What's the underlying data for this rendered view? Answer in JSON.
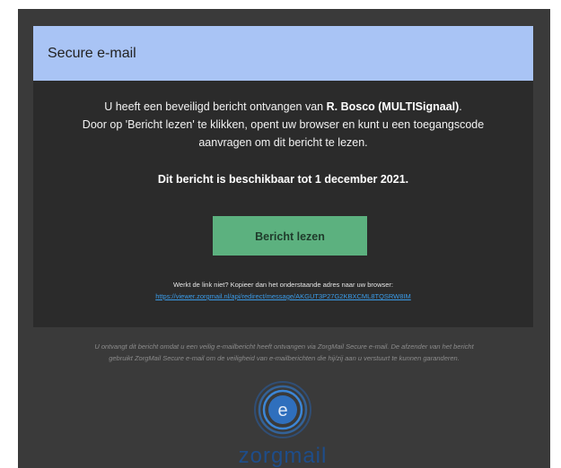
{
  "header": {
    "title": "Secure e-mail"
  },
  "message": {
    "line1_prefix": "U heeft een beveiligd bericht ontvangen van ",
    "sender": "R. Bosco (MULTISignaal)",
    "line1_suffix": ".",
    "line2": "Door op 'Bericht lezen' te klikken, opent uw browser en kunt u een toegangscode",
    "line3": "aanvragen om dit bericht te lezen.",
    "availability": "Dit bericht is beschikbaar tot 1 december 2021."
  },
  "actions": {
    "read_button_label": "Bericht lezen"
  },
  "fallback": {
    "hint": "Werkt de link niet? Kopieer dan het onderstaande adres naar uw browser:",
    "link": "https://viewer.zorgmail.nl/api/redirect/message/AKGUT3P27G2KBXCML8TQSRW8IM"
  },
  "footer": {
    "line1": "U ontvangt dit bericht omdat u een veilig e-mailbericht heeft ontvangen via ZorgMail Secure e-mail. De afzender van het bericht",
    "line2": "gebruikt ZorgMail Secure e-mail om de veiligheid van e-mailberichten die hij/zij aan u verstuurt te kunnen garanderen."
  },
  "brand": {
    "logo_text": "zorgmail",
    "logo_icon": "zorgmail-logo-icon"
  },
  "colors": {
    "header_bg": "#a9c4f5",
    "card_bg": "#2b2b2b",
    "outer_bg": "#3a3a3a",
    "button_bg": "#5cb17f",
    "link": "#3a9be8",
    "brand_blue": "#1e4d8a"
  }
}
